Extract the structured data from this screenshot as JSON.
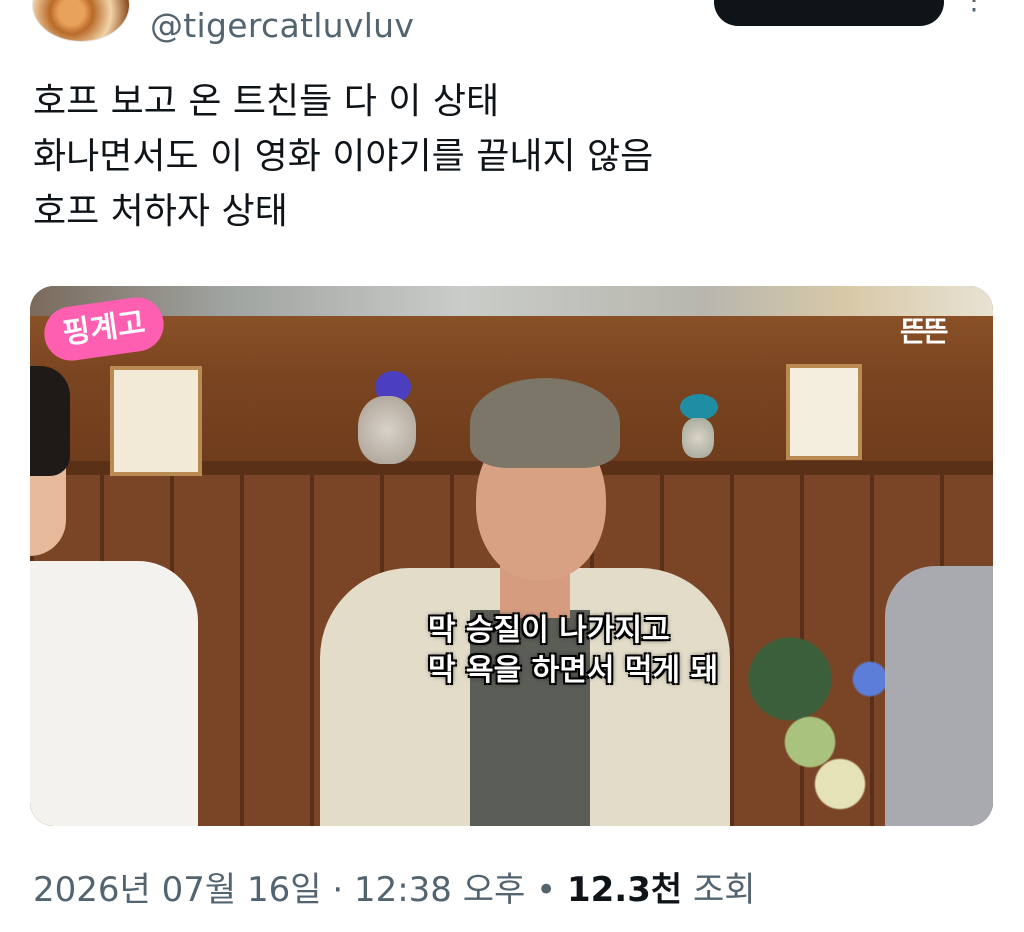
{
  "header": {
    "handle": "@tigercatluvluv",
    "more_glyph": "⋮"
  },
  "tweet": {
    "lines": [
      "호프 보고 온 트친들 다 이 상태",
      "화나면서도 이 영화 이야기를 끝내지 않음",
      "호프 처하자 상태"
    ]
  },
  "media": {
    "badge": "핑계고",
    "channel_mark": "뜬뜬",
    "subtitle_lines": [
      "막 승질이 나가지고",
      "막 욕을 하면서 먹게 돼"
    ]
  },
  "meta": {
    "date": "2026년 07월 16일",
    "sep1": " · ",
    "time": "12:38 오후",
    "sep2": " • ",
    "views_count": "12.3천",
    "views_label": " 조회"
  }
}
